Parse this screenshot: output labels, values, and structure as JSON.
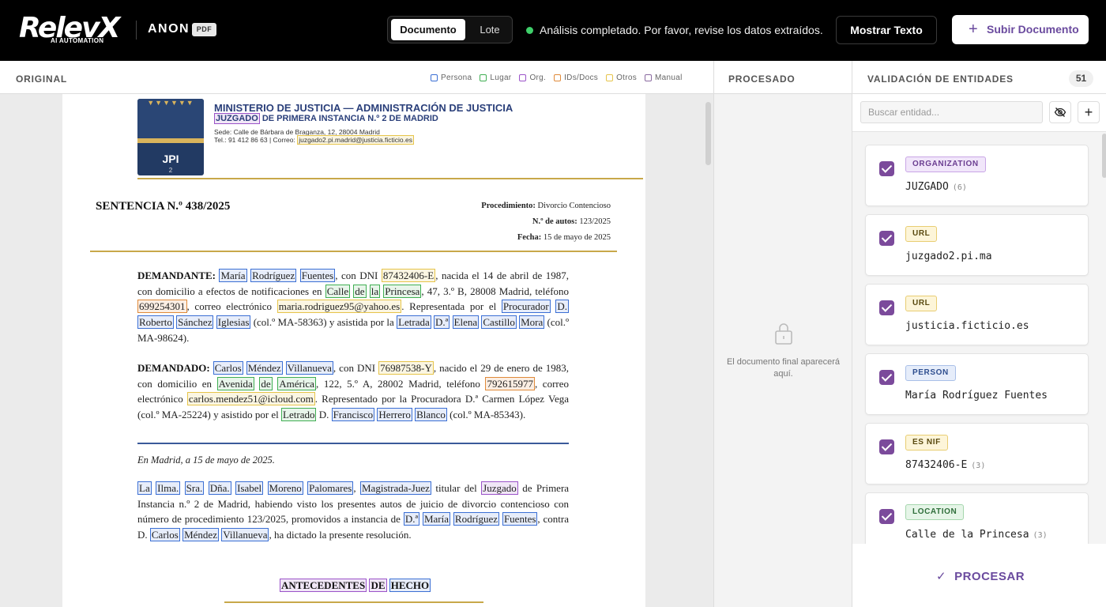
{
  "topbar": {
    "logo_main": "RelevX",
    "logo_sub": "AI AUTOMATION",
    "document_name": "ANON",
    "document_badge": "PDF",
    "mode_documento": "Documento",
    "mode_lote": "Lote",
    "status_text": "Análisis completado. Por favor, revise los datos extraídos.",
    "status_color": "#3fcf6a",
    "show_text_button": "Mostrar Texto",
    "upload_button": "Subir Documento"
  },
  "original": {
    "title": "ORIGINAL",
    "legend": [
      {
        "label": "Persona",
        "color": "#3b6fd4"
      },
      {
        "label": "Lugar",
        "color": "#3fae52"
      },
      {
        "label": "Org.",
        "color": "#9b53c9"
      },
      {
        "label": "IDs/Docs",
        "color": "#e08a3a"
      },
      {
        "label": "Otros",
        "color": "#e6c44a"
      },
      {
        "label": "Manual",
        "color": "#8a6aa0"
      }
    ],
    "doc": {
      "logo_text": "JPI",
      "logo_num": "2",
      "ministry": "MINISTERIO DE JUSTICIA — ADMINISTRACIÓN DE JUSTICIA",
      "juzgado_word": "JUZGADO",
      "juzgado_rest": " DE PRIMERA INSTANCIA N.º 2 DE MADRID",
      "sede": "Sede: Calle de Bárbara de Braganza, 12, 28004 Madrid",
      "tel": "Tel.: 91 412 86 63    |    Correo: ",
      "email": "juzgado2.pi.madrid@justicia.ficticio.es",
      "sentencia": "SENTENCIA N.º 438/2025",
      "proc_label": "Procedimiento:",
      "proc_value": " Divorcio Contencioso",
      "autos_label": "N.º de autos:",
      "autos_value": " 123/2025",
      "fecha_label": "Fecha:",
      "fecha_value": " 15 de mayo de 2025",
      "madrid_date": "En Madrid, a 15 de mayo de 2025.",
      "antecedentes": [
        "ANTECEDENTES",
        "DE",
        "HECHO"
      ]
    }
  },
  "procesado": {
    "title": "PROCESADO",
    "message": "El documento final aparecerá aquí."
  },
  "validacion": {
    "title": "VALIDACIÓN DE ENTIDADES",
    "count": "51",
    "search_placeholder": "Buscar entidad...",
    "entities": [
      {
        "type": "ORGANIZATION",
        "value": "JUZGADO",
        "count": "(6)"
      },
      {
        "type": "URL",
        "value": "juzgado2.pi.ma",
        "count": ""
      },
      {
        "type": "URL",
        "value": "justicia.ficticio.es",
        "count": ""
      },
      {
        "type": "PERSON",
        "value": "María Rodríguez Fuentes",
        "count": ""
      },
      {
        "type": "ES NIF",
        "value": "87432406-E",
        "count": "(3)"
      },
      {
        "type": "LOCATION",
        "value": "Calle de la Princesa",
        "count": "(3)"
      }
    ],
    "process_button": "PROCESAR"
  }
}
